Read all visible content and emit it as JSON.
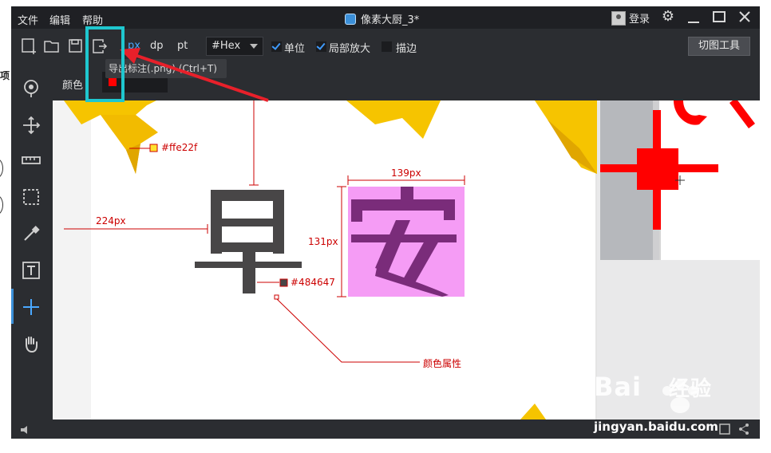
{
  "menu": {
    "file": "文件",
    "edit": "编辑",
    "help": "帮助"
  },
  "window_title": "像素大厨_3*",
  "login_label": "登录",
  "toolbar": {
    "units": [
      "px",
      "dp",
      "pt"
    ],
    "active_unit": "px",
    "color_format": "#Hex",
    "unit_check_label": "单位",
    "zoom_check_label": "局部放大",
    "stroke_check_label": "描边",
    "slice_tool_label": "切图工具"
  },
  "subbar": {
    "color_label": "颜色"
  },
  "tooltip": "导出标注(.png) (Ctrl+T)",
  "annotations": {
    "yellow_color": "#ffe22f",
    "dark_color": "#484647",
    "width_label": "139px",
    "height_label": "131px",
    "distance_label": "224px",
    "color_property_label": "颜色属性"
  },
  "artwork": {
    "char_zao": "早",
    "char_an": "安"
  },
  "watermark": {
    "brand": "Bai",
    "brand_cn": "经验",
    "url": "jingyan.baidu.com"
  },
  "colors": {
    "accent": "#3b8fd8",
    "annotation": "#cc0000",
    "highlight": "#1fc7cf",
    "pink_box": "#f59cf5",
    "yellow": "#ffe22f"
  }
}
